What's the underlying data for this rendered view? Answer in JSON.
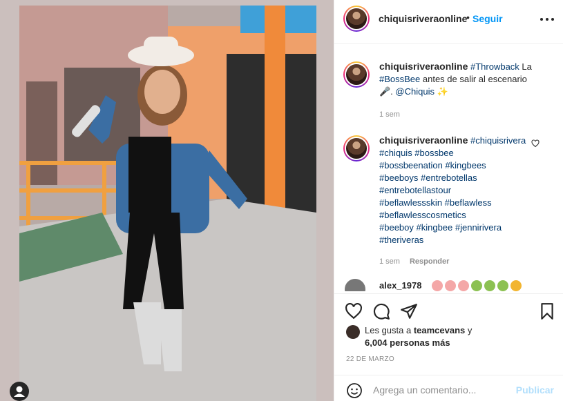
{
  "post": {
    "username": "chiquisriveraonline",
    "follow_label": "Seguir",
    "separator": "•"
  },
  "caption": {
    "username": "chiquisriveraonline",
    "parts": [
      "#Throwback",
      " La ",
      "#BossBee",
      " antes de salir al escenario 🎤. ",
      "@Chiquis",
      " ✨"
    ],
    "time": "1 sem"
  },
  "comments": [
    {
      "username": "chiquisriveraonline",
      "lines": [
        "#chiquisrivera",
        "#chiquis #bossbee",
        "#bossbeenation #kingbees",
        "#beeboys #entrebotellas",
        "#entrebotellastour",
        "#beflawlessskin #beflawless",
        "#beflawlesscosmetics",
        "#beeboy #kingbee #jennirivera",
        "#theriveras"
      ],
      "time": "1 sem",
      "reply_label": "Responder"
    }
  ],
  "partial_comment": {
    "username": "alex_1978",
    "emojis": [
      "pig",
      "pig",
      "pig",
      "nauseated",
      "nauseated",
      "nauseated",
      "angry"
    ]
  },
  "likes": {
    "prefix": "Les gusta a ",
    "liker": "teamcevans",
    "suffix": " y",
    "count_text": "6,004 personas más"
  },
  "date": "22 DE MARZO",
  "add_comment": {
    "placeholder": "Agrega un comentario...",
    "publish_label": "Publicar"
  },
  "colors": {
    "link": "#00376b",
    "follow": "#0095f6",
    "muted": "#8e8e8e",
    "publish_disabled": "#b2dffc"
  },
  "icons": [
    "more-icon",
    "heart-icon",
    "comment-icon",
    "share-icon",
    "bookmark-icon",
    "emoji-icon",
    "user-tag-icon"
  ]
}
